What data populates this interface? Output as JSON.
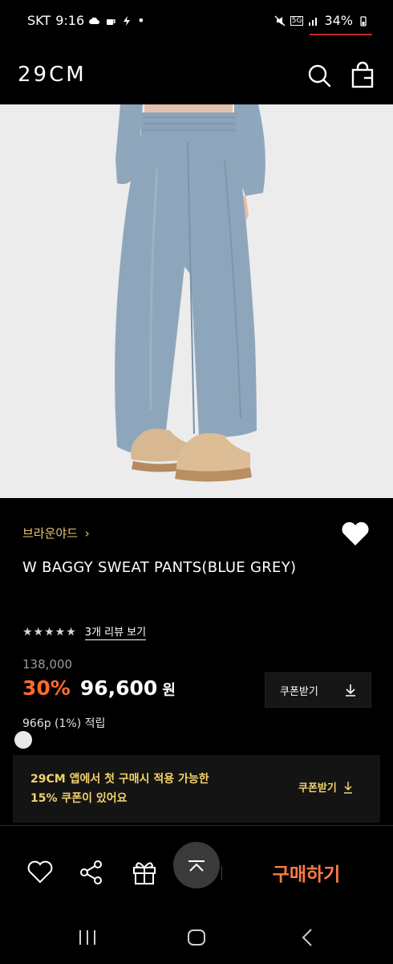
{
  "status_bar": {
    "carrier": "SKT",
    "time": "9:16",
    "network": "5G",
    "battery": "34%"
  },
  "header": {
    "logo": "29CM",
    "search_icon": "search-icon",
    "bag_icon": "shopping-bag-icon"
  },
  "product": {
    "brand": "브라운야드",
    "title": "W BAGGY SWEAT PANTS(BLUE GREY)",
    "stars": "★★★★★",
    "review_link": "3개 리뷰 보기",
    "original_price": "138,000",
    "discount": "30%",
    "sale_price": "96,600",
    "currency": "원",
    "coupon_button": "쿠폰받기",
    "points": "966p (1%) 적립"
  },
  "banner": {
    "line1": "29CM 앱에서 첫 구매시 적용 가능한",
    "line2": "15% 쿠폰이 있어요",
    "coupon_link": "쿠폰받기"
  },
  "action_bar": {
    "buy_label": "구매하기"
  },
  "colors": {
    "accent_orange": "#ff6a2e",
    "brand_gold": "#e7c66b",
    "banner_yellow": "#f4d26a",
    "pants_blue_grey": "#8ea6bc"
  }
}
